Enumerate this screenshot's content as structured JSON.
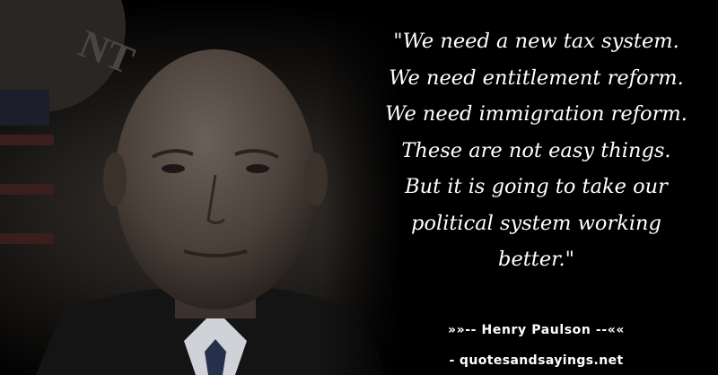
{
  "quote": {
    "lines": [
      "\"We need a new tax system.",
      "We need entitlement reform.",
      "We need immigration reform.",
      "These are not easy things.",
      "But it is going to take our",
      "political system working",
      "better.\""
    ]
  },
  "attribution": {
    "author_line": "»»-- Henry Paulson --««"
  },
  "source": {
    "site_line": "- quotesandsayings.net"
  }
}
